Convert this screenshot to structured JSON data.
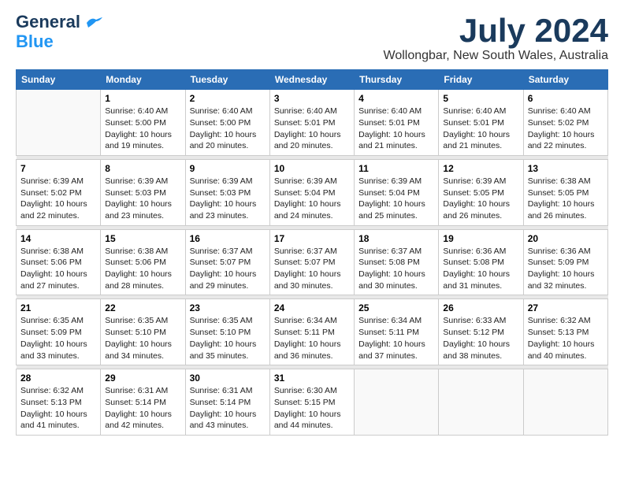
{
  "header": {
    "logo_line1": "General",
    "logo_line2": "Blue",
    "month_year": "July 2024",
    "location": "Wollongbar, New South Wales, Australia"
  },
  "weekdays": [
    "Sunday",
    "Monday",
    "Tuesday",
    "Wednesday",
    "Thursday",
    "Friday",
    "Saturday"
  ],
  "weeks": [
    [
      {
        "day": "",
        "info": ""
      },
      {
        "day": "1",
        "info": "Sunrise: 6:40 AM\nSunset: 5:00 PM\nDaylight: 10 hours\nand 19 minutes."
      },
      {
        "day": "2",
        "info": "Sunrise: 6:40 AM\nSunset: 5:00 PM\nDaylight: 10 hours\nand 20 minutes."
      },
      {
        "day": "3",
        "info": "Sunrise: 6:40 AM\nSunset: 5:01 PM\nDaylight: 10 hours\nand 20 minutes."
      },
      {
        "day": "4",
        "info": "Sunrise: 6:40 AM\nSunset: 5:01 PM\nDaylight: 10 hours\nand 21 minutes."
      },
      {
        "day": "5",
        "info": "Sunrise: 6:40 AM\nSunset: 5:01 PM\nDaylight: 10 hours\nand 21 minutes."
      },
      {
        "day": "6",
        "info": "Sunrise: 6:40 AM\nSunset: 5:02 PM\nDaylight: 10 hours\nand 22 minutes."
      }
    ],
    [
      {
        "day": "7",
        "info": "Sunrise: 6:39 AM\nSunset: 5:02 PM\nDaylight: 10 hours\nand 22 minutes."
      },
      {
        "day": "8",
        "info": "Sunrise: 6:39 AM\nSunset: 5:03 PM\nDaylight: 10 hours\nand 23 minutes."
      },
      {
        "day": "9",
        "info": "Sunrise: 6:39 AM\nSunset: 5:03 PM\nDaylight: 10 hours\nand 23 minutes."
      },
      {
        "day": "10",
        "info": "Sunrise: 6:39 AM\nSunset: 5:04 PM\nDaylight: 10 hours\nand 24 minutes."
      },
      {
        "day": "11",
        "info": "Sunrise: 6:39 AM\nSunset: 5:04 PM\nDaylight: 10 hours\nand 25 minutes."
      },
      {
        "day": "12",
        "info": "Sunrise: 6:39 AM\nSunset: 5:05 PM\nDaylight: 10 hours\nand 26 minutes."
      },
      {
        "day": "13",
        "info": "Sunrise: 6:38 AM\nSunset: 5:05 PM\nDaylight: 10 hours\nand 26 minutes."
      }
    ],
    [
      {
        "day": "14",
        "info": "Sunrise: 6:38 AM\nSunset: 5:06 PM\nDaylight: 10 hours\nand 27 minutes."
      },
      {
        "day": "15",
        "info": "Sunrise: 6:38 AM\nSunset: 5:06 PM\nDaylight: 10 hours\nand 28 minutes."
      },
      {
        "day": "16",
        "info": "Sunrise: 6:37 AM\nSunset: 5:07 PM\nDaylight: 10 hours\nand 29 minutes."
      },
      {
        "day": "17",
        "info": "Sunrise: 6:37 AM\nSunset: 5:07 PM\nDaylight: 10 hours\nand 30 minutes."
      },
      {
        "day": "18",
        "info": "Sunrise: 6:37 AM\nSunset: 5:08 PM\nDaylight: 10 hours\nand 30 minutes."
      },
      {
        "day": "19",
        "info": "Sunrise: 6:36 AM\nSunset: 5:08 PM\nDaylight: 10 hours\nand 31 minutes."
      },
      {
        "day": "20",
        "info": "Sunrise: 6:36 AM\nSunset: 5:09 PM\nDaylight: 10 hours\nand 32 minutes."
      }
    ],
    [
      {
        "day": "21",
        "info": "Sunrise: 6:35 AM\nSunset: 5:09 PM\nDaylight: 10 hours\nand 33 minutes."
      },
      {
        "day": "22",
        "info": "Sunrise: 6:35 AM\nSunset: 5:10 PM\nDaylight: 10 hours\nand 34 minutes."
      },
      {
        "day": "23",
        "info": "Sunrise: 6:35 AM\nSunset: 5:10 PM\nDaylight: 10 hours\nand 35 minutes."
      },
      {
        "day": "24",
        "info": "Sunrise: 6:34 AM\nSunset: 5:11 PM\nDaylight: 10 hours\nand 36 minutes."
      },
      {
        "day": "25",
        "info": "Sunrise: 6:34 AM\nSunset: 5:11 PM\nDaylight: 10 hours\nand 37 minutes."
      },
      {
        "day": "26",
        "info": "Sunrise: 6:33 AM\nSunset: 5:12 PM\nDaylight: 10 hours\nand 38 minutes."
      },
      {
        "day": "27",
        "info": "Sunrise: 6:32 AM\nSunset: 5:13 PM\nDaylight: 10 hours\nand 40 minutes."
      }
    ],
    [
      {
        "day": "28",
        "info": "Sunrise: 6:32 AM\nSunset: 5:13 PM\nDaylight: 10 hours\nand 41 minutes."
      },
      {
        "day": "29",
        "info": "Sunrise: 6:31 AM\nSunset: 5:14 PM\nDaylight: 10 hours\nand 42 minutes."
      },
      {
        "day": "30",
        "info": "Sunrise: 6:31 AM\nSunset: 5:14 PM\nDaylight: 10 hours\nand 43 minutes."
      },
      {
        "day": "31",
        "info": "Sunrise: 6:30 AM\nSunset: 5:15 PM\nDaylight: 10 hours\nand 44 minutes."
      },
      {
        "day": "",
        "info": ""
      },
      {
        "day": "",
        "info": ""
      },
      {
        "day": "",
        "info": ""
      }
    ]
  ]
}
